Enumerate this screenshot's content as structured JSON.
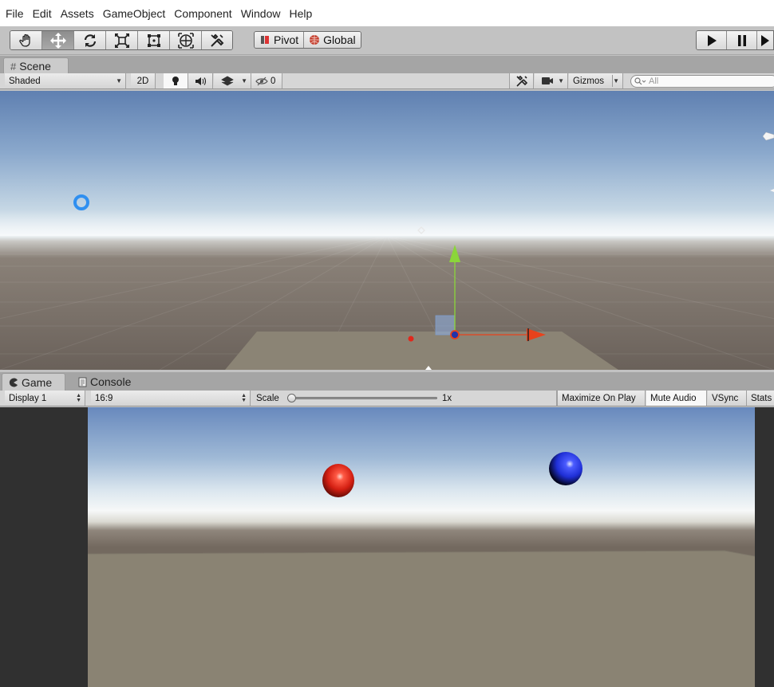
{
  "menu": [
    "File",
    "Edit",
    "Assets",
    "GameObject",
    "Component",
    "Window",
    "Help"
  ],
  "toolbar": {
    "tools": [
      {
        "name": "hand-tool",
        "icon": "hand-icon"
      },
      {
        "name": "move-tool",
        "icon": "move-arrows-icon"
      },
      {
        "name": "rotate-tool",
        "icon": "rotate-icon"
      },
      {
        "name": "scale-tool",
        "icon": "scale-icon"
      },
      {
        "name": "rect-tool",
        "icon": "rect-transform-icon"
      },
      {
        "name": "transform-tool",
        "icon": "transform-icon"
      },
      {
        "name": "custom-tool",
        "icon": "custom-tools-icon"
      }
    ],
    "active_tool": "move-tool",
    "pivot_label": "Pivot",
    "global_label": "Global"
  },
  "scene": {
    "tab_label": "Scene",
    "shading_mode": "Shaded",
    "twod_label": "2D",
    "hidden_count": "0",
    "gizmos_label": "Gizmos",
    "search_placeholder": "All"
  },
  "game": {
    "tab_label": "Game",
    "console_tab_label": "Console",
    "display": "Display 1",
    "aspect": "16:9",
    "scale_label": "Scale",
    "scale_value": "1x",
    "scale_level": 0,
    "maximize_on_play": "Maximize On Play",
    "mute_audio": "Mute Audio",
    "vsync": "VSync",
    "stats": "Stats"
  },
  "colors": {
    "red_sphere": "#e8251c",
    "blue_sphere": "#1f2fd6",
    "gizmo_y": "#8bd63a",
    "gizmo_x": "#e8421c",
    "light_icon": "#2f8ff0"
  }
}
